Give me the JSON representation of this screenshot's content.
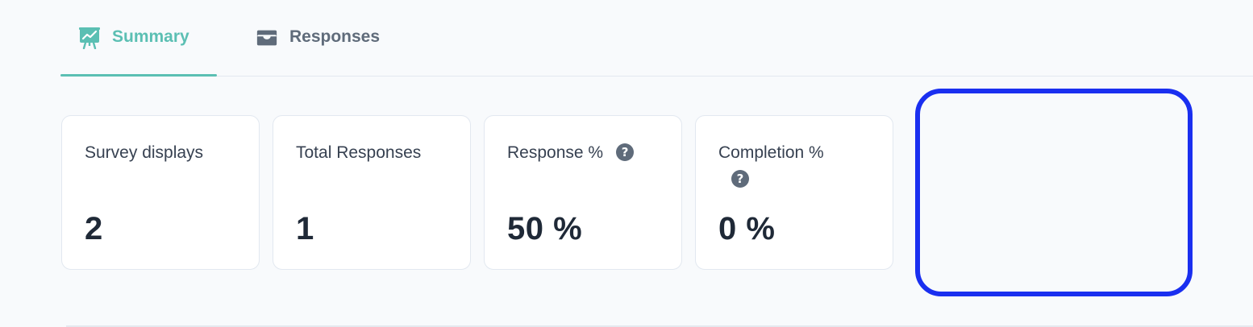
{
  "tabs": [
    {
      "label": "Summary",
      "icon": "presentation-chart-icon",
      "active": true
    },
    {
      "label": "Responses",
      "icon": "inbox-stack-icon",
      "active": false
    }
  ],
  "stats": [
    {
      "label": "Survey displays",
      "value": "2",
      "help": false
    },
    {
      "label": "Total Responses",
      "value": "1",
      "help": false
    },
    {
      "label": "Response %",
      "value": "50 %",
      "help": true
    },
    {
      "label": "Completion %",
      "value": "0 %",
      "help": true
    }
  ],
  "help_glyph": "?",
  "colors": {
    "accent": "#5bbfb3",
    "highlight": "#1a2ff0",
    "text_muted": "#5f6b7a",
    "background": "#f8fafc"
  }
}
